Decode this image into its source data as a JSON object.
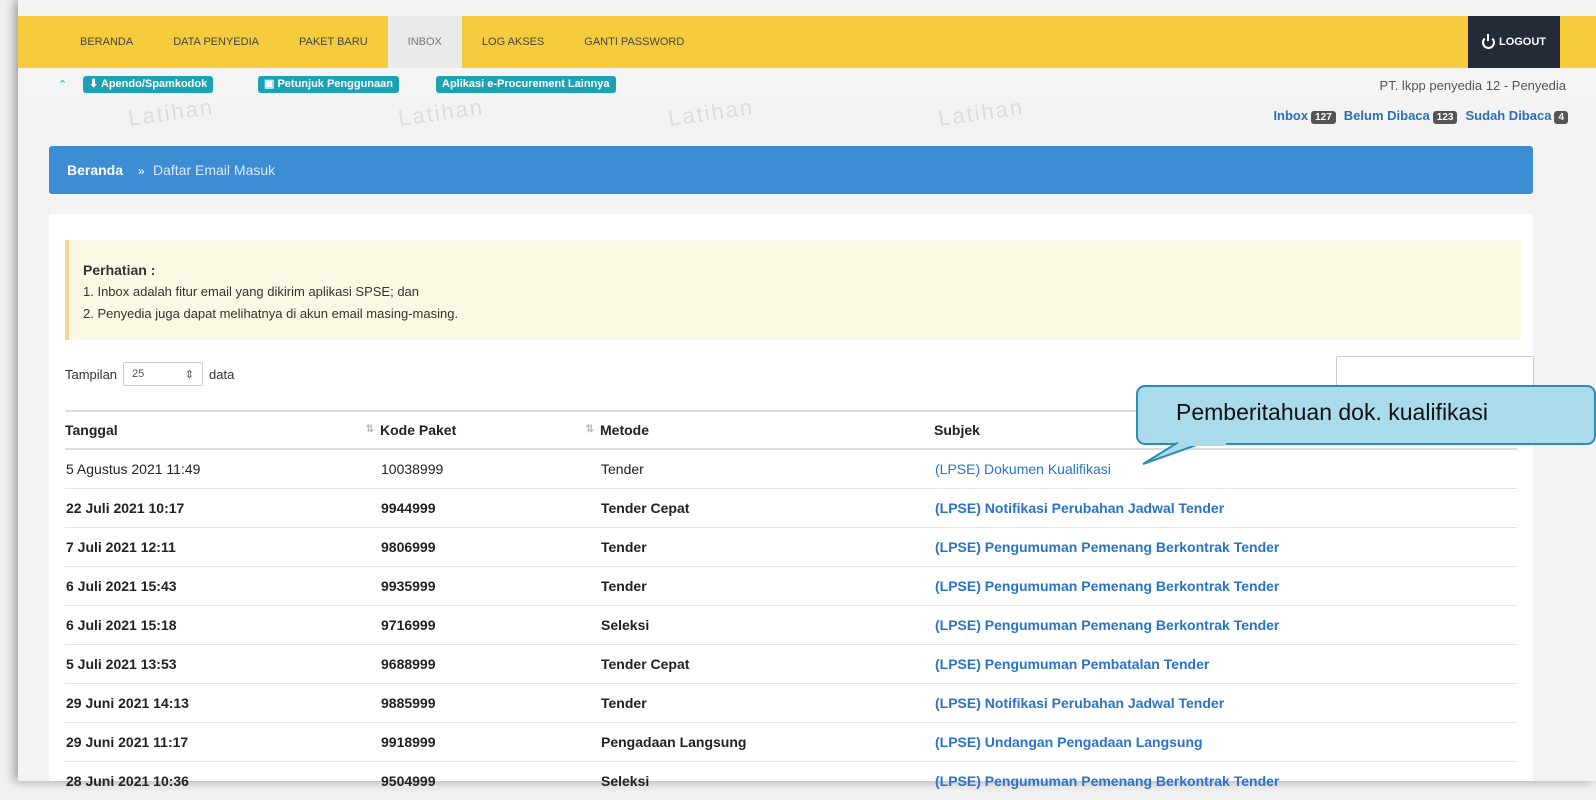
{
  "nav": {
    "items": [
      "BERANDA",
      "DATA PENYEDIA",
      "PAKET BARU",
      "INBOX",
      "LOG AKSES",
      "GANTI PASSWORD"
    ],
    "active_index": 3,
    "logout_label": "LOGOUT"
  },
  "subbar": {
    "links": [
      "Apendo/Spamkodok",
      "Petunjuk Penggunaan",
      "Aplikasi e-Procurement Lainnya"
    ],
    "company": "PT. lkpp penyedia 12 - Penyedia"
  },
  "watermark_text": "Latihan",
  "counts": {
    "inbox_label": "Inbox",
    "inbox_count": "127",
    "unread_label": "Belum Dibaca",
    "unread_count": "123",
    "read_label": "Sudah Dibaca",
    "read_count": "4"
  },
  "breadcrumb": {
    "home": "Beranda",
    "separator": "»",
    "current": "Daftar Email Masuk"
  },
  "notice": {
    "title": "Perhatian :",
    "line1": "1. Inbox adalah fitur email yang dikirim aplikasi SPSE; dan",
    "line2": "2. Penyedia juga dapat melihatnya di akun email masing-masing."
  },
  "tampilan": {
    "label": "Tampilan",
    "value": "25",
    "suffix": "data"
  },
  "table": {
    "headers": [
      "Tanggal",
      "Kode Paket",
      "Metode",
      "Subjek"
    ],
    "rows": [
      {
        "tanggal": "5 Agustus 2021 11:49",
        "kode": "10038999",
        "metode": "Tender",
        "subjek": "(LPSE) Dokumen Kualifikasi",
        "unread": false
      },
      {
        "tanggal": "22 Juli 2021 10:17",
        "kode": "9944999",
        "metode": "Tender Cepat",
        "subjek": "(LPSE) Notifikasi Perubahan Jadwal Tender",
        "unread": true
      },
      {
        "tanggal": "7 Juli 2021 12:11",
        "kode": "9806999",
        "metode": "Tender",
        "subjek": "(LPSE) Pengumuman Pemenang Berkontrak Tender",
        "unread": true
      },
      {
        "tanggal": "6 Juli 2021 15:43",
        "kode": "9935999",
        "metode": "Tender",
        "subjek": "(LPSE) Pengumuman Pemenang Berkontrak Tender",
        "unread": true
      },
      {
        "tanggal": "6 Juli 2021 15:18",
        "kode": "9716999",
        "metode": "Seleksi",
        "subjek": "(LPSE) Pengumuman Pemenang Berkontrak Tender",
        "unread": true
      },
      {
        "tanggal": "5 Juli 2021 13:53",
        "kode": "9688999",
        "metode": "Tender Cepat",
        "subjek": "(LPSE) Pengumuman Pembatalan Tender",
        "unread": true
      },
      {
        "tanggal": "29 Juni 2021 14:13",
        "kode": "9885999",
        "metode": "Tender",
        "subjek": "(LPSE) Notifikasi Perubahan Jadwal Tender",
        "unread": true
      },
      {
        "tanggal": "29 Juni 2021 11:17",
        "kode": "9918999",
        "metode": "Pengadaan Langsung",
        "subjek": "(LPSE) Undangan Pengadaan Langsung",
        "unread": true
      },
      {
        "tanggal": "28 Juni 2021 10:36",
        "kode": "9504999",
        "metode": "Seleksi",
        "subjek": "(LPSE) Pengumuman Pemenang Berkontrak Tender",
        "unread": true
      }
    ]
  },
  "callout": {
    "text": "Pemberitahuan dok. kualifikasi"
  },
  "colors": {
    "topbar": "#f7cc3c",
    "logout": "#242a38",
    "breadcrumb": "#3c8dd4",
    "pill": "#1ba3b4",
    "link": "#2a73c7",
    "callout": "#a9dbeb"
  }
}
